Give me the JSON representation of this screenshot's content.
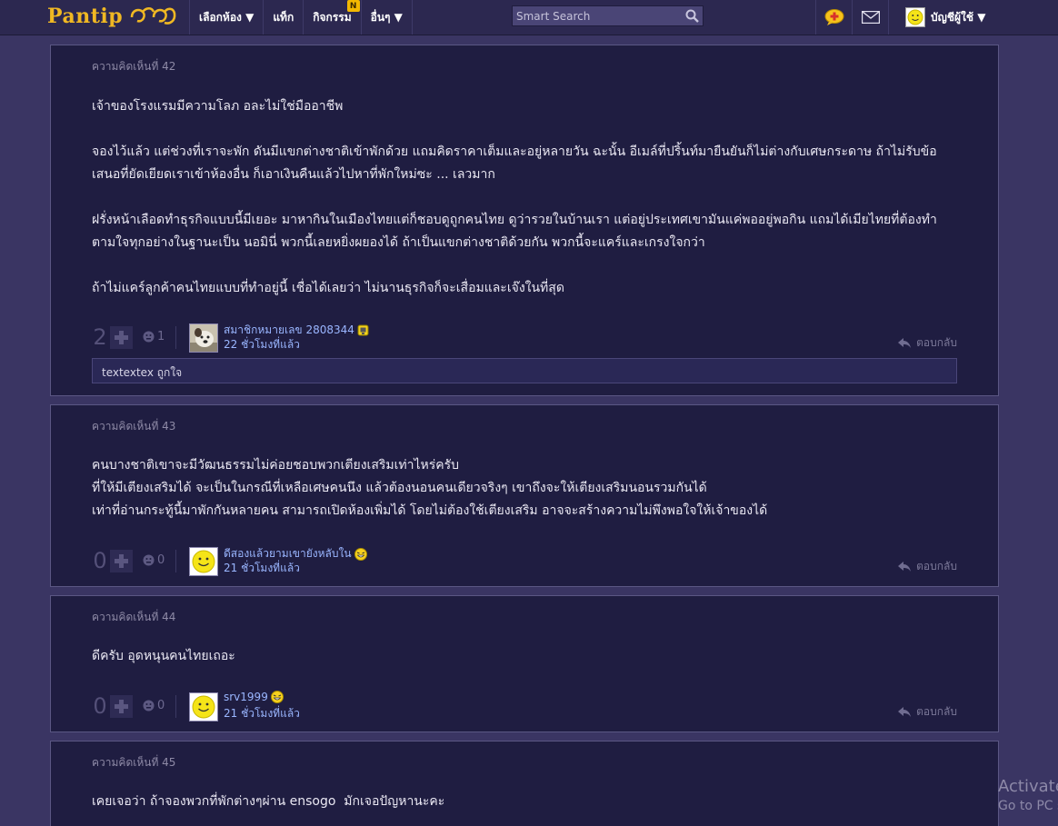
{
  "header": {
    "logo_text": "Pantip",
    "nav": [
      {
        "label": "เลือกห้อง ▼"
      },
      {
        "label": "แท็ก"
      },
      {
        "label": "กิจกรรม",
        "badge": "N"
      },
      {
        "label": "อื่นๆ ▼"
      }
    ],
    "search_placeholder": "Smart Search",
    "account_label": "บัญชีผู้ใช้ ▼",
    "icons": [
      "chat-plus-icon",
      "mail-icon"
    ]
  },
  "comments": [
    {
      "number": "ความคิดเห็นที่ 42",
      "body": "เจ้าของโรงแรมมีความโลภ อละไม่ใช่มืออาชีพ\n\nจองไว้แล้ว แต่ช่วงที่เราจะพัก ดันมีแขกต่างชาติเข้าพักด้วย แถมคิดราคาเต็มและอยู่หลายวัน ฉะนั้น อีเมล์ที่ปริ้นท์มายืนยันก็ไม่ต่างกับเศษกระดาษ ถ้าไม่รับข้อเสนอที่ยัดเยียดเราเข้าห้องอื่น ก็เอาเงินคืนแล้วไปหาที่พักใหม่ซะ ... เลวมาก\n\nฝรั่งหน้าเลือดทำธุรกิจแบบนี้มีเยอะ มาหากินในเมืองไทยแต่ก็ชอบดูถูกคนไทย ดูว่ารวยในบ้านเรา แต่อยู่ประเทศเขามันแค่พออยู่พอกิน แถมได้เมียไทยที่ต้องทำตามใจทุกอย่างในฐานะเป็น นอมินี่ พวกนี้เลยหยิ่งผยองได้ ถ้าเป็นแขกต่างชาติด้วยกัน พวกนี้จะแคร์และเกรงใจกว่า\n\nถ้าไม่แคร์ลูกค้าคนไทยแบบที่ทำอยู่นี้ เชื่อได้เลยว่า ไม่นานธุรกิจก็จะเสื่อมและเจ๊งในที่สุด",
      "score": "2",
      "emotion_count": "1",
      "user": "สมาชิกหมายเลข 2808344",
      "time": "22 ชั่วโมงที่แล้ว",
      "avatar": "dog-photo",
      "reply_label": "ตอบกลับ",
      "likes_text": "textextex ถูกใจ"
    },
    {
      "number": "ความคิดเห็นที่ 43",
      "body": "คนบางชาติเขาจะมีวัฒนธรรมไม่ค่อยชอบพวกเตียงเสริมเท่าไหร่ครับ\nที่ให้มีเตียงเสริมได้ จะเป็นในกรณีที่เหลือเศษคนนึง แล้วต้องนอนคนเดียวจริงๆ เขาถึงจะให้เตียงเสริมนอนรวมกันได้\nเท่าที่อ่านกระทู้นี้มาพักกันหลายคน สามารถเปิดห้องเพิ่มได้ โดยไม่ต้องใช้เตียงเสริม อาจจะสร้างความไม่พึงพอใจให้เจ้าของได้",
      "score": "0",
      "emotion_count": "0",
      "user": "ดีสองแล้วยามเขายังหลับใน",
      "time": "21 ชั่วโมงที่แล้ว",
      "avatar": "smiley",
      "reply_label": "ตอบกลับ"
    },
    {
      "number": "ความคิดเห็นที่ 44",
      "body": "ดีครับ อุดหนุนคนไทยเถอะ",
      "score": "0",
      "emotion_count": "0",
      "user": "srv1999",
      "time": "21 ชั่วโมงที่แล้ว",
      "avatar": "smiley",
      "reply_label": "ตอบกลับ"
    },
    {
      "number": "ความคิดเห็นที่ 45",
      "body": "เคยเจอว่า ถ้าจองพวกที่พักต่างๆผ่าน ensogo  มักเจอปัญหานะคะ"
    }
  ],
  "watermark": {
    "line1": "Activate",
    "line2": "Go to PC s"
  },
  "colors": {
    "background": "#3a3563",
    "card": "#1f1d41",
    "logo": "#f0b823",
    "link": "#9ab6ff"
  }
}
